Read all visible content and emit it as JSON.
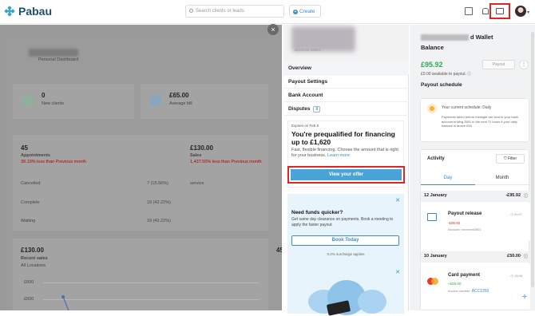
{
  "app": {
    "name": "Pabau"
  },
  "topbar": {
    "search_placeholder": "Search clients or leads",
    "create_label": "Create"
  },
  "dashboard": {
    "subtitle": "Personal Dashboard",
    "stats": [
      {
        "value": "0",
        "label": "New clients"
      },
      {
        "value": "£65.00",
        "label": "Average bill"
      }
    ],
    "appointments": {
      "value": "45",
      "label": "Appointments",
      "change": "39.19% less than Previous month"
    },
    "sales": {
      "value": "£130.00",
      "label": "Sales",
      "change": "1,437.50% less than Previous month"
    },
    "rows": [
      {
        "label": "Cancelled",
        "value": "7 (15.56%)"
      },
      {
        "label": "Complete",
        "value": "19 (42.22%)"
      },
      {
        "label": "Waiting",
        "value": "19 (42.22%)"
      }
    ],
    "service_label": "service",
    "recent_sales": {
      "value": "£130.00",
      "label": "Recent sales",
      "location": "All Locations",
      "y_ticks": [
        "£600",
        "£500"
      ]
    },
    "side_value": "45"
  },
  "wallet_menu": {
    "subtitle": "Business Wallet",
    "items": [
      {
        "label": "Overview"
      },
      {
        "label": "Payout Settings"
      },
      {
        "label": "Bank Account"
      },
      {
        "label": "Disputes",
        "count": "0"
      }
    ]
  },
  "offer": {
    "expires": "Expires on Feb 8",
    "title": "You're prequalified for financing up to £1,620",
    "desc": "Fast, flexible financing. Choose the amount that is right for your business.",
    "learn_more": "Learn more",
    "button": "View your offer"
  },
  "funds": {
    "title": "Need funds quicker?",
    "desc": "Get same day clearance on payments. Book a meeting to apply the faster payout",
    "button": "Book Today",
    "note": "0.2% surcharge applies"
  },
  "wallet": {
    "title_suffix": "d Wallet",
    "balance_label": "Balance",
    "amount": "£95.92",
    "available": "£0.00 available to payout.",
    "payout_button": "Payout",
    "schedule_label": "Payout schedule",
    "schedule_current": "Your current schedule: Daily",
    "schedule_text": "Payments taken before midnight are sent to your bank account ending 3501 in the next 72 hours if your daily balance is above £50.",
    "activity_label": "Activity",
    "filter_label": "Filter",
    "tabs": [
      "Day",
      "Month"
    ],
    "groups": [
      {
        "date": "12 January",
        "total": "-£95.92",
        "tx": {
          "name": "Payout release",
          "amount": "-£95.92",
          "sub": "Account: xxxxxxxx3501",
          "time": "00:07"
        }
      },
      {
        "date": "10 January",
        "total": "£50.00",
        "tx": {
          "name": "Card payment",
          "amount": "+£50.00",
          "sub": "Invoice number:",
          "invoice": "ACC1350",
          "time": "15:08"
        }
      }
    ]
  },
  "colors": {
    "accent": "#3a8bd1",
    "green": "#2faa55",
    "highlight": "#e02424"
  }
}
